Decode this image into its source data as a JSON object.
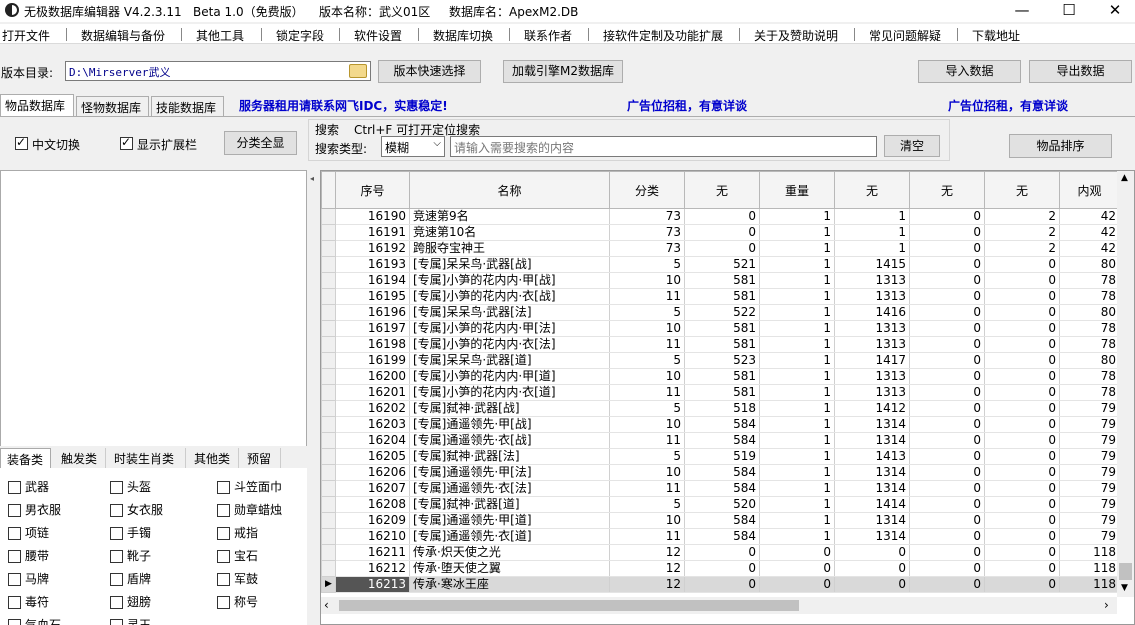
{
  "window": {
    "app_name": "无极数据库编辑器 V4.2.3.11",
    "edition": "Beta 1.0（免费版）",
    "version_name": "版本名称：武义01区",
    "db_name": "数据库名：ApexM2.DB",
    "minimize": "—",
    "maximize": "☐",
    "close": "✕"
  },
  "menu": [
    "打开文件",
    "数据编辑与备份",
    "其他工具",
    "锁定字段",
    "软件设置",
    "数据库切换",
    "联系作者",
    "接软件定制及功能扩展",
    "关于及赞助说明",
    "常见问题解疑",
    "下载地址"
  ],
  "toolbar": {
    "dir_label": "版本目录:",
    "dir_value": "D:\\Mirserver武义",
    "quick_select": "版本快速选择",
    "load_engine": "加载引擎M2数据库",
    "import": "导入数据",
    "export": "导出数据"
  },
  "tabs": [
    "物品数据库",
    "怪物数据库",
    "技能数据库"
  ],
  "ads": {
    "ad1": "服务器租用请联系网飞IDC，实惠稳定!",
    "ad2": "广告位招租，有意详谈",
    "ad3": "广告位招租，有意详谈"
  },
  "filters": {
    "chinese_switch": "中文切换",
    "show_ext": "显示扩展栏",
    "show_all": "分类全显",
    "search_title": "搜索",
    "search_hint": "Ctrl+F 可打开定位搜索",
    "search_type_label": "搜索类型:",
    "search_type_value": "模糊",
    "search_placeholder": "请输入需要搜索的内容",
    "clear": "清空",
    "sort": "物品排序"
  },
  "left_tabs": [
    "装备类",
    "触发类",
    "时装生肖类",
    "其他类",
    "预留"
  ],
  "categories": [
    "武器",
    "头盔",
    "斗笠面巾",
    "男衣服",
    "女衣服",
    "勋章蜡烛",
    "项链",
    "手镯",
    "戒指",
    "腰带",
    "靴子",
    "宝石",
    "马牌",
    "盾牌",
    "军鼓",
    "毒符",
    "翅膀",
    "称号",
    "气血石",
    "灵玉"
  ],
  "grid": {
    "columns": [
      "序号",
      "名称",
      "分类",
      "无",
      "重量",
      "无",
      "无",
      "无",
      "内观"
    ],
    "rows": [
      [
        "16190",
        "竞速第9名",
        "73",
        "0",
        "1",
        "1",
        "0",
        "2",
        "42"
      ],
      [
        "16191",
        "竞速第10名",
        "73",
        "0",
        "1",
        "1",
        "0",
        "2",
        "42"
      ],
      [
        "16192",
        "跨服夺宝神王",
        "73",
        "0",
        "1",
        "1",
        "0",
        "2",
        "42"
      ],
      [
        "16193",
        "[专属]呆呆鸟·武器[战]",
        "5",
        "521",
        "1",
        "1415",
        "0",
        "0",
        "80"
      ],
      [
        "16194",
        "[专属]小笋的花内内·甲[战]",
        "10",
        "581",
        "1",
        "1313",
        "0",
        "0",
        "78"
      ],
      [
        "16195",
        "[专属]小笋的花内内·衣[战]",
        "11",
        "581",
        "1",
        "1313",
        "0",
        "0",
        "78"
      ],
      [
        "16196",
        "[专属]呆呆鸟·武器[法]",
        "5",
        "522",
        "1",
        "1416",
        "0",
        "0",
        "80"
      ],
      [
        "16197",
        "[专属]小笋的花内内·甲[法]",
        "10",
        "581",
        "1",
        "1313",
        "0",
        "0",
        "78"
      ],
      [
        "16198",
        "[专属]小笋的花内内·衣[法]",
        "11",
        "581",
        "1",
        "1313",
        "0",
        "0",
        "78"
      ],
      [
        "16199",
        "[专属]呆呆鸟·武器[道]",
        "5",
        "523",
        "1",
        "1417",
        "0",
        "0",
        "80"
      ],
      [
        "16200",
        "[专属]小笋的花内内·甲[道]",
        "10",
        "581",
        "1",
        "1313",
        "0",
        "0",
        "78"
      ],
      [
        "16201",
        "[专属]小笋的花内内·衣[道]",
        "11",
        "581",
        "1",
        "1313",
        "0",
        "0",
        "78"
      ],
      [
        "16202",
        "[专属]弑神·武器[战]",
        "5",
        "518",
        "1",
        "1412",
        "0",
        "0",
        "79"
      ],
      [
        "16203",
        "[专属]通遥领先·甲[战]",
        "10",
        "584",
        "1",
        "1314",
        "0",
        "0",
        "79"
      ],
      [
        "16204",
        "[专属]通遥领先·衣[战]",
        "11",
        "584",
        "1",
        "1314",
        "0",
        "0",
        "79"
      ],
      [
        "16205",
        "[专属]弑神·武器[法]",
        "5",
        "519",
        "1",
        "1413",
        "0",
        "0",
        "79"
      ],
      [
        "16206",
        "[专属]通遥领先·甲[法]",
        "10",
        "584",
        "1",
        "1314",
        "0",
        "0",
        "79"
      ],
      [
        "16207",
        "[专属]通遥领先·衣[法]",
        "11",
        "584",
        "1",
        "1314",
        "0",
        "0",
        "79"
      ],
      [
        "16208",
        "[专属]弑神·武器[道]",
        "5",
        "520",
        "1",
        "1414",
        "0",
        "0",
        "79"
      ],
      [
        "16209",
        "[专属]通遥领先·甲[道]",
        "10",
        "584",
        "1",
        "1314",
        "0",
        "0",
        "79"
      ],
      [
        "16210",
        "[专属]通遥领先·衣[道]",
        "11",
        "584",
        "1",
        "1314",
        "0",
        "0",
        "79"
      ],
      [
        "16211",
        "传承·炽天使之光",
        "12",
        "0",
        "0",
        "0",
        "0",
        "0",
        "118"
      ],
      [
        "16212",
        "传承·堕天使之翼",
        "12",
        "0",
        "0",
        "0",
        "0",
        "0",
        "118"
      ],
      [
        "16213",
        "传承·寒冰王座",
        "12",
        "0",
        "0",
        "0",
        "0",
        "0",
        "118"
      ]
    ],
    "selected_index": 23
  }
}
